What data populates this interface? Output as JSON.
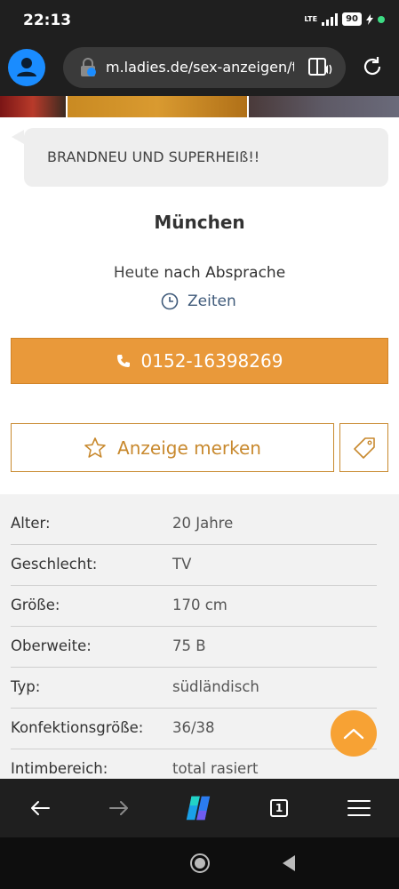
{
  "status_bar": {
    "time": "22:13",
    "network": "LTE",
    "battery": "90"
  },
  "browser": {
    "url": "m.ladies.de/sex-anzeigen/t"
  },
  "ad": {
    "headline": "BRANDNEU UND SUPERHEIß!!",
    "city": "München",
    "availability_day": "Heute",
    "availability_text": "nach Absprache",
    "times_link": "Zeiten",
    "phone": "0152-16398269",
    "bookmark_label": "Anzeige merken"
  },
  "details": [
    {
      "label": "Alter:",
      "value": "20 Jahre"
    },
    {
      "label": "Geschlecht:",
      "value": "TV"
    },
    {
      "label": "Größe:",
      "value": "170 cm"
    },
    {
      "label": "Oberweite:",
      "value": "75 B"
    },
    {
      "label": "Typ:",
      "value": "südländisch"
    },
    {
      "label": "Konfektionsgröße:",
      "value": "36/38"
    },
    {
      "label": "Intimbereich:",
      "value": "total rasiert"
    }
  ],
  "browser_nav": {
    "tab_count": "1"
  },
  "colors": {
    "accent": "#e9993a",
    "outline": "#c8892e",
    "scroll_top": "#f7a234",
    "link": "#3f5a7a"
  },
  "icons": [
    "profile-icon",
    "site-lock-icon",
    "reader-mode-icon",
    "reload-icon",
    "clock-icon",
    "phone-icon",
    "star-icon",
    "tag-icon",
    "chevron-up-icon",
    "back-arrow-icon",
    "forward-arrow-icon",
    "copilot-icon",
    "menu-icon",
    "home-icon",
    "back-triangle-icon"
  ]
}
